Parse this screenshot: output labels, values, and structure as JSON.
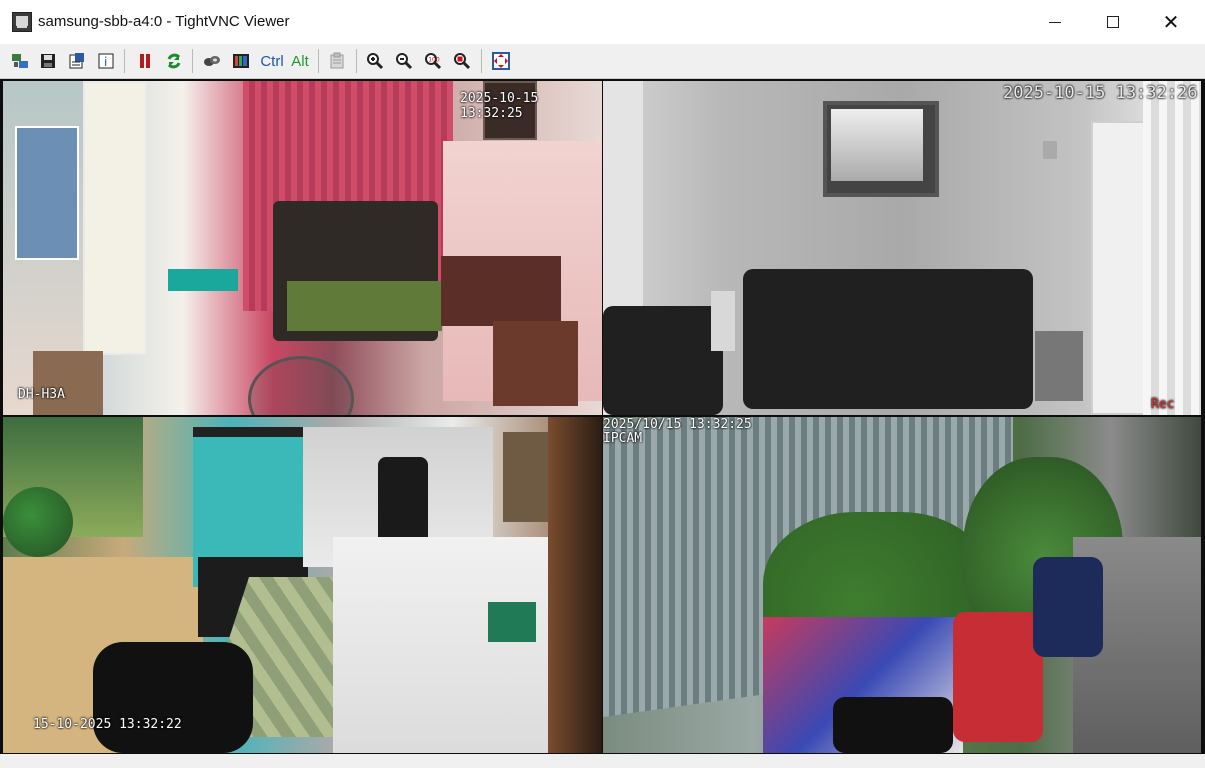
{
  "window": {
    "title": "samsung-sbb-a4:0 - TightVNC Viewer",
    "controls": {
      "minimize_icon": "minimize-icon",
      "maximize_icon": "maximize-icon",
      "close_icon": "close-icon"
    }
  },
  "toolbar": {
    "items": [
      {
        "name": "new-connection-icon"
      },
      {
        "name": "save-session-icon"
      },
      {
        "name": "options-icon"
      },
      {
        "name": "connection-info-icon"
      },
      {
        "name": "pause-icon"
      },
      {
        "name": "refresh-icon"
      },
      {
        "name": "transfer-files-icon"
      },
      {
        "name": "ctrl-alt-del-icon"
      },
      {
        "name": "ctrl-key",
        "label": "Ctrl"
      },
      {
        "name": "alt-key",
        "label": "Alt"
      },
      {
        "name": "clipboard-icon"
      },
      {
        "name": "zoom-in-icon"
      },
      {
        "name": "zoom-out-icon"
      },
      {
        "name": "zoom-100-icon"
      },
      {
        "name": "zoom-fit-icon"
      },
      {
        "name": "full-screen-icon"
      }
    ]
  },
  "cameras": [
    {
      "timestamp": "2025-10-15 13:32:25",
      "label": "DH-H3A"
    },
    {
      "timestamp": "2025-10-15 13:32:26",
      "label": "Rec"
    },
    {
      "timestamp": "15-10-2025 13:32:22"
    },
    {
      "timestamp": "2025/10/15 13:32:25",
      "label": "IPCAM"
    }
  ]
}
